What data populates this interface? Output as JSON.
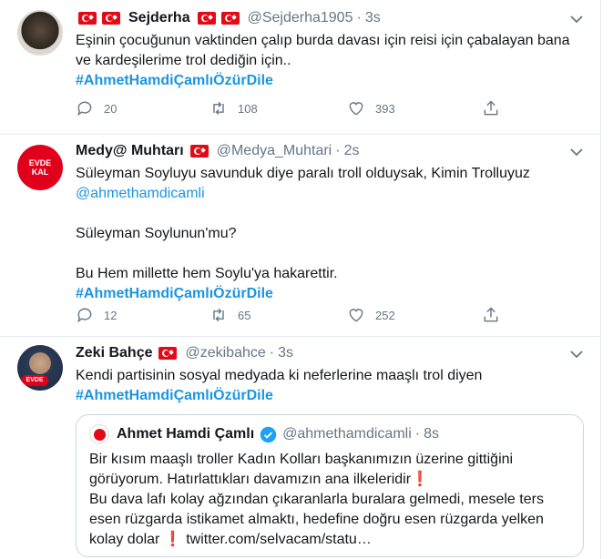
{
  "tweets": [
    {
      "name": "Sejderha",
      "handle": "@Sejderha1905",
      "dot": "·",
      "time": "3s",
      "text": "Eşinin çocuğunun vaktinden çalıp burda davası için reisi için çabalayan bana ve kardeşilerime trol dediğin için..",
      "hashtag": "#AhmetHamdiÇamlıÖzürDile",
      "replies": "20",
      "retweets": "108",
      "likes": "393"
    },
    {
      "name": "Medy@ Muhtarı",
      "handle": "@Medya_Muhtari",
      "dot": "·",
      "time": "2s",
      "text_line1": "Süleyman Soyluyu savunduk diye paralı troll olduysak, Kimin Trolluyuz",
      "mention": "@ahmethamdicamli",
      "text_line2": "Süleyman Soylunun'mu?",
      "text_line3": "Bu Hem millette hem Soylu'ya hakarettir.",
      "hashtag": "#AhmetHamdiÇamlıÖzürDile",
      "avatar_text_1": "EVDE",
      "avatar_text_2": "KAL",
      "replies": "12",
      "retweets": "65",
      "likes": "252"
    },
    {
      "name": "Zeki Bahçe",
      "handle": "@zekibahce",
      "dot": "·",
      "time": "3s",
      "text": "Kendi partisinin sosyal medyada ki neferlerine maaşlı trol diyen",
      "hashtag": "#AhmetHamdiÇamlıÖzürDile",
      "avatar_text": "EVDE"
    }
  ],
  "quote": {
    "name": "Ahmet Hamdi Çamlı",
    "handle": "@ahmethamdicamli",
    "dot": "·",
    "time": "8s",
    "line1": "Bir kısım maaşlı troller Kadın Kolları başkanımızın üzerine gittiğini",
    "line2": "görüyorum. Hatırlattıkları davamızın ana ilkeleridir",
    "line3": "Bu dava lafı kolay ağzından çıkaranlarla buralara gelmedi, mesele ters",
    "line4": "esen rüzgarda istikamet almaktı, hedefine doğru esen rüzgarda yelken",
    "line5_start": "kolay dolar",
    "line5_link": "twitter.com/selvacam/statu…",
    "exclaim": "❗"
  },
  "colors": {
    "accent": "#1b95e0",
    "muted": "#657786",
    "flag": "#e30a17"
  }
}
